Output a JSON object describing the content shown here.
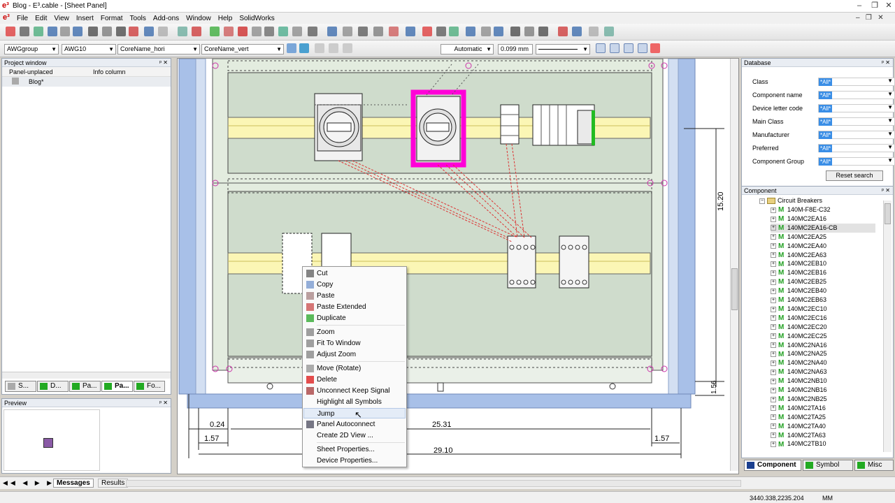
{
  "window": {
    "title": "Blog - E³.cable - [Sheet Panel]"
  },
  "menu": [
    "File",
    "Edit",
    "View",
    "Insert",
    "Format",
    "Tools",
    "Add-ons",
    "Window",
    "Help",
    "SolidWorks"
  ],
  "toolbar2": {
    "combo1": "AWGgroup",
    "combo2": "AWG10",
    "combo3": "CoreName_hori",
    "combo4": "CoreName_vert",
    "combo5": "Automatic",
    "combo6": "0.099 mm"
  },
  "project_window": {
    "title": "Project window",
    "col1": "Panel-unplaced",
    "col2": "Info column",
    "item": "Blog*",
    "tabs": [
      "S...",
      "D...",
      "Pa...",
      "Pa...",
      "Fo..."
    ]
  },
  "preview": {
    "title": "Preview"
  },
  "messages_tabs": [
    "Messages",
    "Results"
  ],
  "drawing": {
    "dim_0_24": "0.24",
    "dim_1_57a": "1.57",
    "dim_25_31": "25.31",
    "dim_1_57b": "1.57",
    "dim_29_10": "29.10",
    "dim_15_20": "15.20",
    "dim_1_56": "1.56"
  },
  "context_menu": {
    "items": [
      {
        "label": "Cut",
        "icon": "scissors-icon"
      },
      {
        "label": "Copy",
        "icon": "copy-icon"
      },
      {
        "label": "Paste",
        "icon": "paste-icon"
      },
      {
        "label": "Paste Extended",
        "icon": "paste-extended-icon"
      },
      {
        "label": "Duplicate",
        "icon": "duplicate-icon"
      },
      {
        "label": "Zoom",
        "icon": "zoom-icon"
      },
      {
        "label": "Fit To Window",
        "icon": "fit-window-icon"
      },
      {
        "label": "Adjust Zoom",
        "icon": "adjust-zoom-icon"
      },
      {
        "label": "Move (Rotate)",
        "icon": "hand-icon"
      },
      {
        "label": "Delete",
        "icon": "delete-x-icon"
      },
      {
        "label": "Unconnect Keep Signal",
        "icon": "unconnect-icon"
      },
      {
        "label": "Highlight all Symbols",
        "icon": ""
      },
      {
        "label": "Jump",
        "icon": ""
      },
      {
        "label": "Panel Autoconnect",
        "icon": "autoconnect-icon"
      },
      {
        "label": "Create 2D View ...",
        "icon": ""
      },
      {
        "label": "Sheet Properties...",
        "icon": ""
      },
      {
        "label": "Device Properties...",
        "icon": ""
      }
    ]
  },
  "database": {
    "title": "Database",
    "filters": [
      {
        "label": "Class",
        "value": "*All*"
      },
      {
        "label": "Component name",
        "value": "*All*"
      },
      {
        "label": "Device letter code",
        "value": "*All*"
      },
      {
        "label": "Main Class",
        "value": "*All*"
      },
      {
        "label": "Manufacturer",
        "value": "*All*"
      },
      {
        "label": "Preferred",
        "value": "*All*"
      },
      {
        "label": "Component Group",
        "value": "*All*"
      }
    ],
    "reset_label": "Reset search",
    "component_title": "Component",
    "folder": "Circuit Breakers",
    "components": [
      "140M-F8E-C32",
      "140MC2EA16",
      "140MC2EA16-CB",
      "140MC2EA25",
      "140MC2EA40",
      "140MC2EA63",
      "140MC2EB10",
      "140MC2EB16",
      "140MC2EB25",
      "140MC2EB40",
      "140MC2EB63",
      "140MC2EC10",
      "140MC2EC16",
      "140MC2EC20",
      "140MC2EC25",
      "140MC2NA16",
      "140MC2NA25",
      "140MC2NA40",
      "140MC2NA63",
      "140MC2NB10",
      "140MC2NB16",
      "140MC2NB25",
      "140MC2TA16",
      "140MC2TA25",
      "140MC2TA40",
      "140MC2TA63",
      "140MC2TB10"
    ],
    "tabs": [
      "Component",
      "Symbol",
      "Misc"
    ]
  },
  "status": {
    "coords": "3440.338,2235.204",
    "unit": "MM"
  },
  "colors": {
    "highlight": "#ff00d8",
    "rail": "#fbf6b5",
    "plate": "#cfdccc",
    "frame": "#a8c0e8"
  }
}
